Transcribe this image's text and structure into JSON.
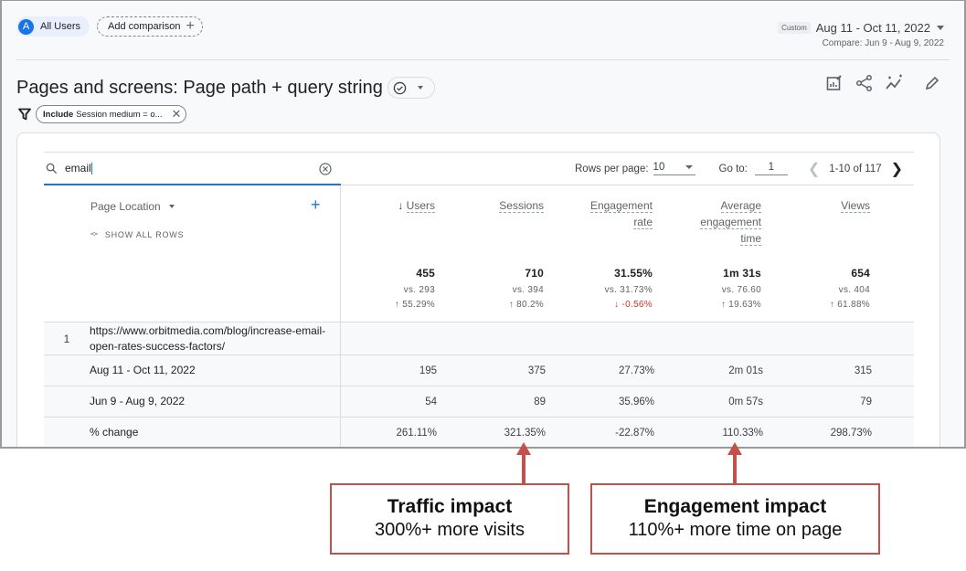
{
  "header": {
    "segment": {
      "avatar_letter": "A",
      "label": "All Users"
    },
    "add_comparison_label": "Add comparison",
    "date_tag": "Custom",
    "date_range": "Aug 11 - Oct 11, 2022",
    "compare_range": "Compare: Jun 9 - Aug 9, 2022"
  },
  "report": {
    "title": "Pages and screens: Page path + query string",
    "actions": [
      "customize-report-icon",
      "share-icon",
      "insights-icon",
      "edit-icon"
    ],
    "filter": {
      "bold": "Include",
      "text": "Session medium = o..."
    }
  },
  "table": {
    "search_value": "email",
    "rows_per_page_label": "Rows per page:",
    "rows_per_page": "10",
    "goto_label": "Go to:",
    "goto_value": "1",
    "page_range": "1-10 of 117",
    "dimension_header": "Page Location",
    "show_all_rows": "SHOW ALL ROWS",
    "columns": [
      {
        "label_lines": [
          "Users"
        ],
        "sorted": true,
        "total": "455",
        "vs": "vs. 293",
        "change": "55.29%",
        "direction": "up"
      },
      {
        "label_lines": [
          "Sessions"
        ],
        "sorted": false,
        "total": "710",
        "vs": "vs. 394",
        "change": "80.2%",
        "direction": "up"
      },
      {
        "label_lines": [
          "Engagement",
          "rate"
        ],
        "sorted": false,
        "total": "31.55%",
        "vs": "vs. 31.73%",
        "change": "-0.56%",
        "direction": "down"
      },
      {
        "label_lines": [
          "Average",
          "engagement",
          "time"
        ],
        "sorted": false,
        "total": "1m 31s",
        "vs": "vs. 76.60",
        "change": "19.63%",
        "direction": "up"
      },
      {
        "label_lines": [
          "Views"
        ],
        "sorted": false,
        "total": "654",
        "vs": "vs. 404",
        "change": "61.88%",
        "direction": "up"
      }
    ],
    "rows": [
      {
        "index": "1",
        "dimension": "https://www.orbitmedia.com/blog/increase-email-open-rates-success-factors/",
        "values": [
          "",
          "",
          "",
          "",
          ""
        ]
      },
      {
        "index": "",
        "dimension": "Aug 11 - Oct 11, 2022",
        "values": [
          "195",
          "375",
          "27.73%",
          "2m 01s",
          "315"
        ]
      },
      {
        "index": "",
        "dimension": "Jun 9 - Aug 9, 2022",
        "values": [
          "54",
          "89",
          "35.96%",
          "0m 57s",
          "79"
        ]
      },
      {
        "index": "",
        "dimension": "% change",
        "values": [
          "261.11%",
          "321.35%",
          "-22.87%",
          "110.33%",
          "298.73%"
        ]
      }
    ]
  },
  "annotations": [
    {
      "title": "Traffic impact",
      "subtitle": "300%+ more visits",
      "points_to": "Sessions % change"
    },
    {
      "title": "Engagement impact",
      "subtitle": "110%+ more time on page",
      "points_to": "Average engagement time % change"
    }
  ],
  "colors": {
    "accent": "#1a73e8",
    "negative": "#d93025",
    "annotation": "#c5504b"
  }
}
